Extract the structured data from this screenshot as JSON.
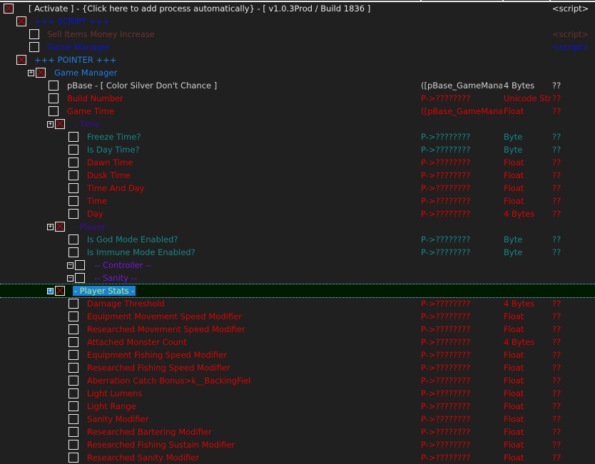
{
  "colors": {
    "background": "#202020",
    "white": "#e8e8e8",
    "red": "#e00000",
    "dark_red": "#6e3030",
    "blue": "#0a14e0",
    "light_blue": "#1e7fe8",
    "teal": "#148888",
    "purple": "#3c0aa0",
    "violet": "#7814e0",
    "silver": "#d0d0d0",
    "selection_bg": "#1e7fd8",
    "selection_text": "#a4ff6a"
  },
  "header": {
    "title": "[ Activate ] - {Click here to add process automatically} - [ v1.0.3Prod / Build 1836 ]",
    "value": "<script>"
  },
  "rows": [
    {
      "id": "script-group",
      "label": "+++ SCRIPT +++",
      "checked": true,
      "color": "blue",
      "value": ""
    },
    {
      "id": "sell-items",
      "label": "Sell Items Money Increase",
      "checked": false,
      "color": "dark_red",
      "value": "<script>"
    },
    {
      "id": "game-manager-script",
      "label": "Game Manager",
      "checked": false,
      "color": "blue",
      "value": "<script>"
    },
    {
      "id": "pointer-group",
      "label": "+++ POINTER +++",
      "checked": true,
      "color": "light_blue"
    },
    {
      "id": "game-manager-pointer",
      "label": "Game Manager",
      "checked": true,
      "color": "light_blue",
      "expander": "+"
    },
    {
      "id": "pbase",
      "label": "pBase - [ Color Silver Don't Chance ]",
      "checked": false,
      "color": "silver",
      "address": "([pBase_GameManage",
      "type": "4 Bytes",
      "value": "??"
    },
    {
      "id": "build-number",
      "label": "Build Number",
      "checked": false,
      "color": "red",
      "address": "P->????????",
      "type": "Unicode String",
      "value": "??"
    },
    {
      "id": "game-time",
      "label": "Game Time",
      "checked": false,
      "color": "red",
      "address": "([pBase_GameManage",
      "type": "Float",
      "value": "??"
    },
    {
      "id": "time-group",
      "label": "- Time -",
      "checked": true,
      "color": "purple",
      "expander": "+"
    },
    {
      "id": "freeze-time",
      "label": "Freeze Time?",
      "checked": false,
      "color": "teal",
      "address": "P->????????",
      "type": "Byte",
      "value": "??"
    },
    {
      "id": "is-day-time",
      "label": "Is Day Time?",
      "checked": false,
      "color": "teal",
      "address": "P->????????",
      "type": "Byte",
      "value": "??"
    },
    {
      "id": "dawn-time",
      "label": "Dawn Time",
      "checked": false,
      "color": "red",
      "address": "P->????????",
      "type": "Float",
      "value": "??"
    },
    {
      "id": "dusk-time",
      "label": "Dusk Time",
      "checked": false,
      "color": "red",
      "address": "P->????????",
      "type": "Float",
      "value": "??"
    },
    {
      "id": "time-and-day",
      "label": "Time And Day",
      "checked": false,
      "color": "red",
      "address": "P->????????",
      "type": "Float",
      "value": "??"
    },
    {
      "id": "time",
      "label": "Time",
      "checked": false,
      "color": "red",
      "address": "P->????????",
      "type": "Float",
      "value": "??"
    },
    {
      "id": "day",
      "label": "Day",
      "checked": false,
      "color": "red",
      "address": "P->????????",
      "type": "4 Bytes",
      "value": "??"
    },
    {
      "id": "player-group",
      "label": "- Player -",
      "checked": true,
      "color": "purple",
      "expander": "+"
    },
    {
      "id": "god-mode",
      "label": "Is God Mode Enabled?",
      "checked": false,
      "color": "teal",
      "address": "P->????????",
      "type": "Byte",
      "value": "??"
    },
    {
      "id": "immune-mode",
      "label": "Is Immune Mode Enabled?",
      "checked": false,
      "color": "teal",
      "address": "P->????????",
      "type": "Byte",
      "value": "??"
    },
    {
      "id": "controller-group",
      "label": "-- Controller --",
      "checked": false,
      "color": "violet",
      "expander": "-"
    },
    {
      "id": "sanity-group",
      "label": "-- Sanity --",
      "checked": false,
      "color": "violet",
      "expander": "-"
    },
    {
      "id": "player-stats-group",
      "label": "- Player Stats -",
      "checked": true,
      "color": "selection",
      "expander": "+",
      "selected": true
    },
    {
      "id": "damage-threshold",
      "label": "Damage Threshold",
      "checked": false,
      "color": "red",
      "address": "P->????????",
      "type": "4 Bytes",
      "value": "??"
    },
    {
      "id": "equip-move-speed",
      "label": "Equipment Movement Speed Modifier",
      "checked": false,
      "color": "red",
      "address": "P->????????",
      "type": "Float",
      "value": "??"
    },
    {
      "id": "research-move-speed",
      "label": "Researched Movement Speed Modifier",
      "checked": false,
      "color": "red",
      "address": "P->????????",
      "type": "Float",
      "value": "??"
    },
    {
      "id": "attached-monster",
      "label": "Attached Monster Count",
      "checked": false,
      "color": "red",
      "address": "P->????????",
      "type": "4 Bytes",
      "value": "??"
    },
    {
      "id": "equip-fishing-speed",
      "label": "Equipment Fishing Speed Modifier",
      "checked": false,
      "color": "red",
      "address": "P->????????",
      "type": "Float",
      "value": "??"
    },
    {
      "id": "research-fishing-speed",
      "label": "Researched Fishing Speed Modifier",
      "checked": false,
      "color": "red",
      "address": "P->????????",
      "type": "Float",
      "value": "??"
    },
    {
      "id": "aberration-catch",
      "label": "Aberration Catch Bonus>k__BackingFiel",
      "checked": false,
      "color": "red",
      "address": "P->????????",
      "type": "Float",
      "value": "??"
    },
    {
      "id": "light-lumens",
      "label": "Light Lumens",
      "checked": false,
      "color": "red",
      "address": "P->????????",
      "type": "Float",
      "value": "??"
    },
    {
      "id": "light-range",
      "label": "Light Range",
      "checked": false,
      "color": "red",
      "address": "P->????????",
      "type": "Float",
      "value": "??"
    },
    {
      "id": "sanity-modifier",
      "label": "Sanity Modifier",
      "checked": false,
      "color": "red",
      "address": "P->????????",
      "type": "Float",
      "value": "??"
    },
    {
      "id": "research-bartering",
      "label": "Researched Bartering Modifier",
      "checked": false,
      "color": "red",
      "address": "P->????????",
      "type": "Float",
      "value": "??"
    },
    {
      "id": "research-fishing-sustain",
      "label": "Researched Fishing Sustain Modifier",
      "checked": false,
      "color": "red",
      "address": "P->????????",
      "type": "Float",
      "value": "??"
    },
    {
      "id": "research-sanity",
      "label": "Researched Sanity Modifier",
      "checked": false,
      "color": "red",
      "address": "P->????????",
      "type": "Float",
      "value": "??"
    }
  ]
}
